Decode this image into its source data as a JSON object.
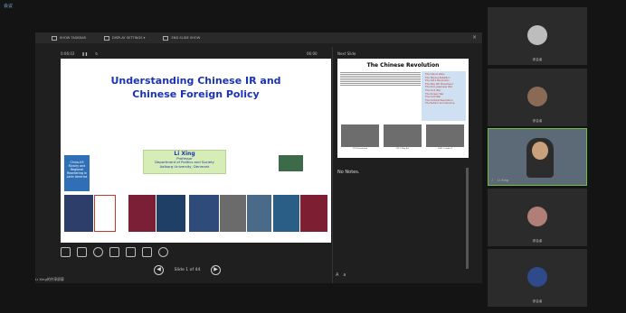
{
  "window": {
    "title": "会议"
  },
  "presenter_toolbar": {
    "items": [
      "SHOW TASKBAR",
      "DISPLAY SETTINGS ▾",
      "END SLIDE SHOW"
    ]
  },
  "timer": {
    "elapsed": "0:06:03",
    "pause_icon": "pause-icon",
    "reset_icon": "reset-icon"
  },
  "clock": "06:00",
  "next_label": "Next Slide",
  "slide": {
    "title_line1": "Understanding Chinese IR and",
    "title_line2": "Chinese Foreign Policy",
    "name": "Li Xing",
    "role": "Professor",
    "dept": "Department of Politics and Society",
    "univ": "Aalborg University, Denmark",
    "side_left": "China-US Rivalry and Regional Reordering in Latin America",
    "book1": "The Rise of China and the Capitalist World Order",
    "book3": "China and the Americas",
    "book4": "China-EU Relations in an era of Global Transformations",
    "book5": "The BRICS and Beyond",
    "book8": "Mapping China's One Belt One Road Initiative",
    "book9": "The Rise of China and the Capitalist World Order"
  },
  "next_slide": {
    "title": "The Chinese Revolution",
    "list": [
      "The Opium Wars",
      "The Taiping Rebellion",
      "The 1911 Revolution",
      "The May 4th Movement",
      "The Sino-Japanese War",
      "The Civil War",
      "The Korean War",
      "The Cold War",
      "The Cultural Revolution",
      "The Reform and Opening"
    ],
    "captions": [
      "1911 Revolution",
      "1919, May 4th",
      "1949, October 1"
    ]
  },
  "notes": "No Notes.",
  "nav": {
    "slide_num": "Slide 1 of 44",
    "prev": "◀",
    "next": "▶"
  },
  "presenter_name": "Li Xing的共享屏幕",
  "participants": [
    {
      "name": "参会者",
      "kind": "avatar"
    },
    {
      "name": "参会者",
      "kind": "avatar-photo"
    },
    {
      "name": "Li Xing",
      "kind": "video"
    },
    {
      "name": "参会者",
      "kind": "avatar-photo"
    },
    {
      "name": "参会者",
      "kind": "avatar-globe"
    }
  ],
  "colors": {
    "title_blue": "#1a33b5",
    "active_border": "#6fbe3f"
  }
}
